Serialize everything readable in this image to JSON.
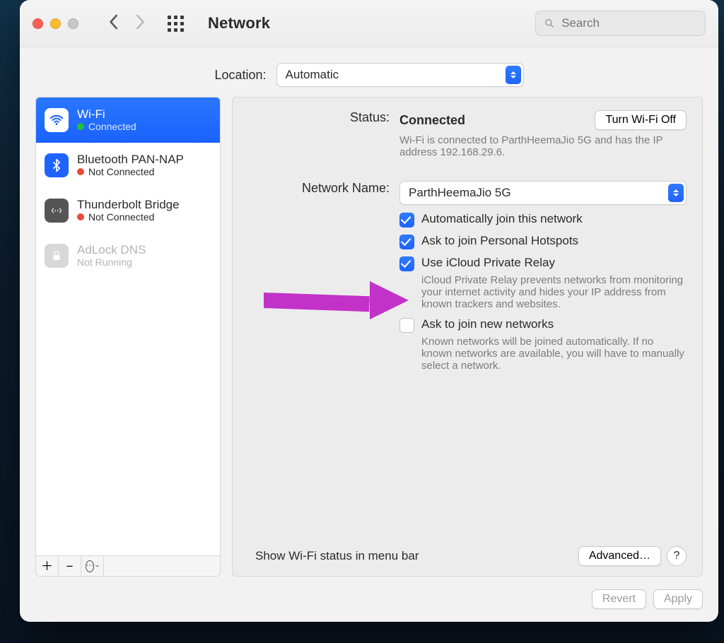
{
  "title": "Network",
  "search": {
    "placeholder": "Search"
  },
  "location": {
    "label": "Location:",
    "value": "Automatic"
  },
  "services": [
    {
      "name": "Wi-Fi",
      "status": "Connected",
      "dot": "green",
      "iconBg": "#ffffff",
      "iconFg": "#1f63ff",
      "active": true,
      "kind": "wifi"
    },
    {
      "name": "Bluetooth PAN-NAP",
      "status": "Not Connected",
      "dot": "red",
      "iconBg": "#1f63ff",
      "iconFg": "#ffffff",
      "active": false,
      "kind": "bt"
    },
    {
      "name": "Thunderbolt Bridge",
      "status": "Not Connected",
      "dot": "red",
      "iconBg": "#555555",
      "iconFg": "#ffffff",
      "active": false,
      "kind": "tb"
    },
    {
      "name": "AdLock DNS",
      "status": "Not Running",
      "dot": "",
      "iconBg": "#d8d8d8",
      "iconFg": "#ffffff",
      "active": false,
      "kind": "lock"
    }
  ],
  "details": {
    "statusLabel": "Status:",
    "statusValue": "Connected",
    "toggleBtn": "Turn Wi-Fi Off",
    "statusDesc": "Wi-Fi is connected to ParthHeemaJio 5G and has the IP address 192.168.29.6.",
    "networkNameLabel": "Network Name:",
    "networkNameValue": "ParthHeemaJio 5G",
    "autoJoin": "Automatically join this network",
    "askHotspot": "Ask to join Personal Hotspots",
    "privateRelay": "Use iCloud Private Relay",
    "privateRelayDesc": "iCloud Private Relay prevents networks from monitoring your internet activity and hides your IP address from known trackers and websites.",
    "askNew": "Ask to join new networks",
    "askNewDesc": "Known networks will be joined automatically. If no known networks are available, you will have to manually select a network.",
    "showMenuBar": "Show Wi-Fi status in menu bar",
    "advanced": "Advanced…",
    "help": "?"
  },
  "footer": {
    "revert": "Revert",
    "apply": "Apply"
  },
  "checks": {
    "autoJoin": true,
    "askHotspot": true,
    "privateRelay": true,
    "askNew": false,
    "showMenuBar": true
  }
}
